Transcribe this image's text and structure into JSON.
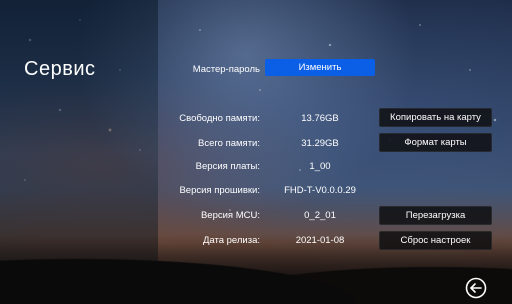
{
  "page": {
    "title": "Сервис"
  },
  "master_password": {
    "label": "Мастер-пароль",
    "button": "Изменить"
  },
  "rows": [
    {
      "label": "Свободно памяти:",
      "value": "13.76GB"
    },
    {
      "label": "Всего памяти:",
      "value": "31.29GB"
    },
    {
      "label": "Версия платы:",
      "value": "1_00"
    },
    {
      "label": "Версия прошивки:",
      "value": "FHD-T-V0.0.0.29"
    },
    {
      "label": "Версия MCU:",
      "value": "0_2_01"
    },
    {
      "label": "Дата релиза:",
      "value": "2021-01-08"
    }
  ],
  "buttons": {
    "copy_to_card": "Копировать на карту",
    "format_card": "Формат карты",
    "reboot": "Перезагрузка",
    "factory_reset": "Сброс настроек"
  },
  "icons": {
    "back": "back-arrow-circle-icon"
  },
  "colors": {
    "accent_button": "#0b5ee6",
    "dark_button": "#0f0f12",
    "text": "#ffffff"
  }
}
